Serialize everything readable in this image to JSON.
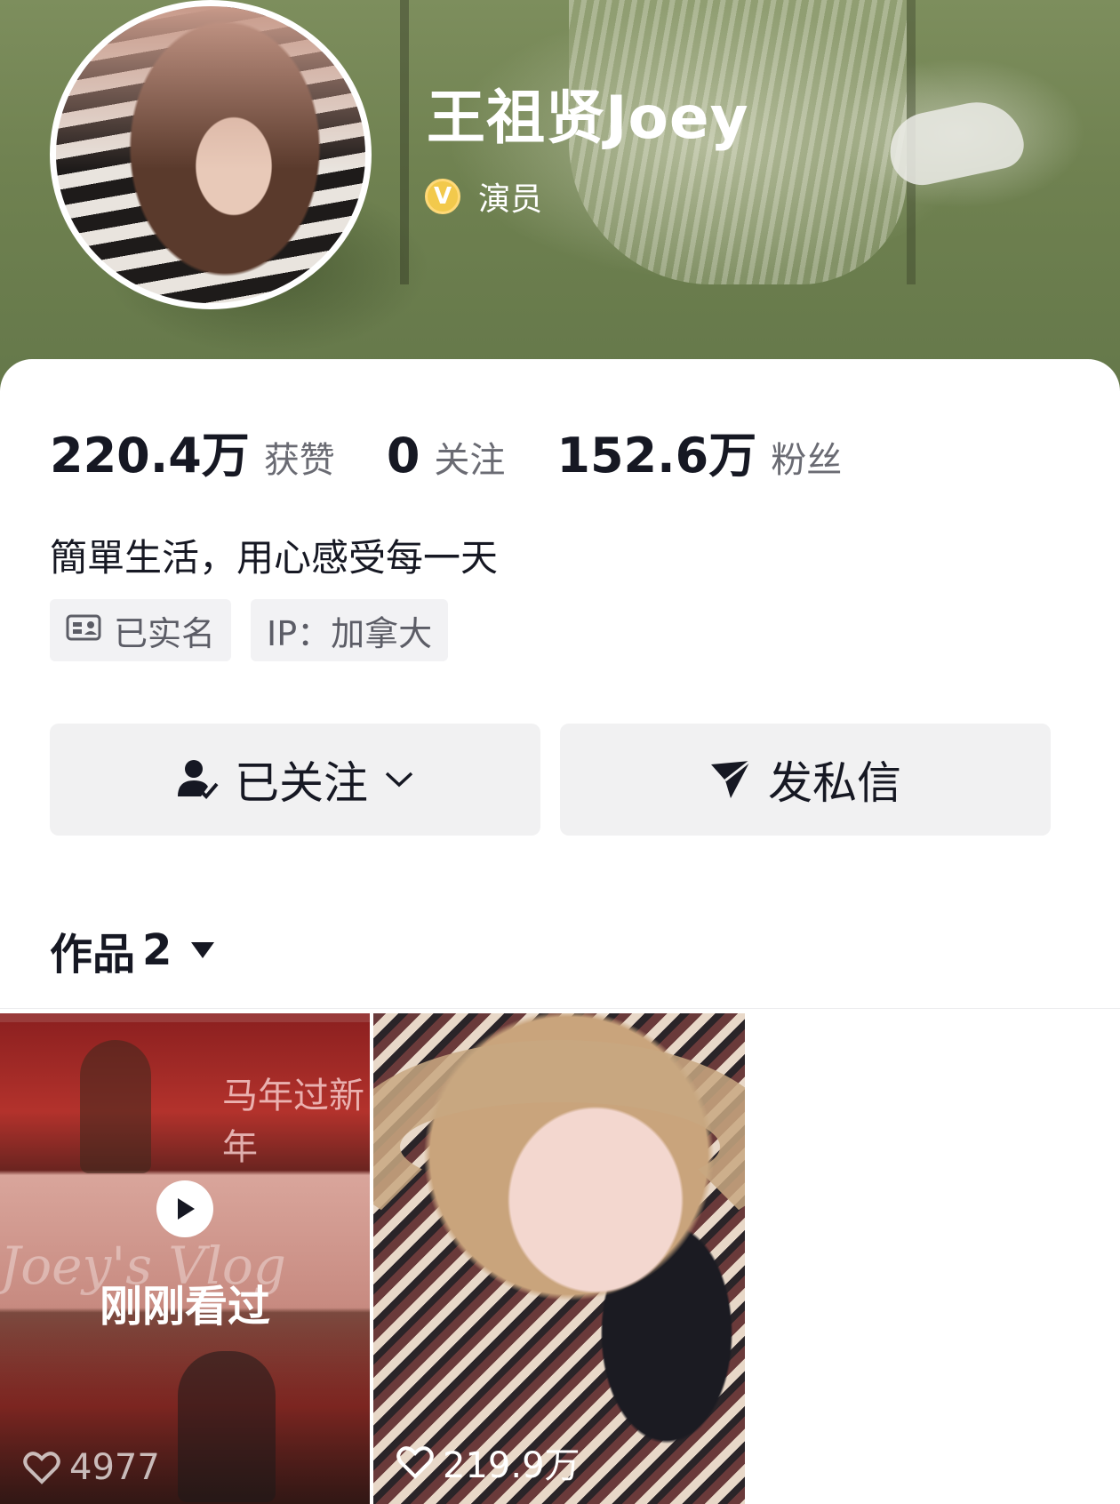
{
  "profile": {
    "name": "王祖贤Joey",
    "role": "演员",
    "badge_letter": "V"
  },
  "stats": [
    {
      "value": "220.4万",
      "label": "获赞"
    },
    {
      "value": "0",
      "label": "关注"
    },
    {
      "value": "152.6万",
      "label": "粉丝"
    }
  ],
  "bio": "簡單生活，用心感受每一天",
  "tags": {
    "verified": "已实名",
    "ip": "IP：加拿大"
  },
  "actions": {
    "follow": "已关注",
    "message": "发私信"
  },
  "works": {
    "label": "作品",
    "count": "2"
  },
  "videos": [
    {
      "overlay": "刚刚看过",
      "likes": "4977",
      "decor_text_1": "马年过新年",
      "decor_text_2": "Joey's Vlog"
    },
    {
      "likes": "219.9万"
    }
  ],
  "colors": {
    "header_green": "#6f8150",
    "text_primary": "#161823",
    "text_secondary": "#6a6b73",
    "button_bg": "#f1f1f2",
    "badge_gold": "#f2c94c"
  },
  "icons": [
    "verified-v-icon",
    "id-card-icon",
    "user-check-icon",
    "chevron-down-icon",
    "send-icon",
    "caret-down-icon",
    "play-icon",
    "heart-icon"
  ]
}
